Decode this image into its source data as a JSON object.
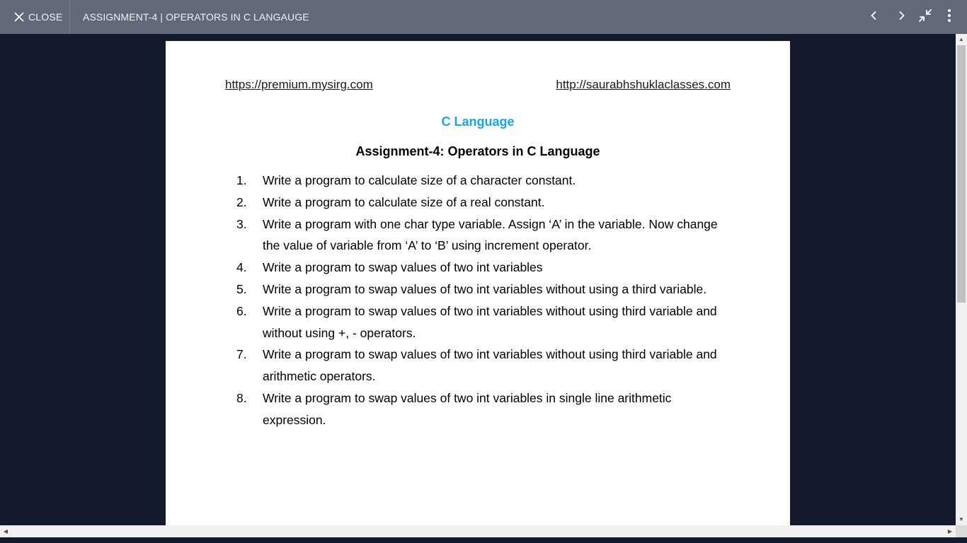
{
  "topbar": {
    "close_label": "CLOSE",
    "title": "ASSIGNMENT-4 | OPERATORS IN C LANGAUGE",
    "icons": [
      "close-icon",
      "chevron-left-icon",
      "chevron-right-icon",
      "exit-fullscreen-icon",
      "more-vert-icon"
    ]
  },
  "document": {
    "link_left": "https://premium.mysirg.com",
    "link_right": "http://saurabhshuklaclasses.com",
    "course": "C Language",
    "heading": "Assignment-4: Operators in C Language",
    "questions": [
      {
        "num": "1.",
        "text": "Write a program to calculate size of a character constant."
      },
      {
        "num": "2.",
        "text": "Write a program to calculate size of a real constant."
      },
      {
        "num": "3.",
        "text": "Write a program with one char type variable. Assign ‘A’ in the variable. Now change the value of variable from ‘A’ to ‘B’ using increment operator."
      },
      {
        "num": "4.",
        "text": "Write a program to swap values of two int variables"
      },
      {
        "num": "5.",
        "text": "Write a program to swap values of two int variables without using a third variable."
      },
      {
        "num": "6.",
        "text": "Write a program to swap values of two int variables without using third variable and without using +, - operators."
      },
      {
        "num": "7.",
        "text": "Write a program to swap values of two int variables without using third variable and arithmetic operators."
      },
      {
        "num": "8.",
        "text": "Write a program to swap values of two int variables in single line arithmetic expression."
      }
    ]
  },
  "colors": {
    "topbar_bg": "#606879",
    "viewer_bg": "#151b2e",
    "course_title": "#1aa3e8"
  }
}
